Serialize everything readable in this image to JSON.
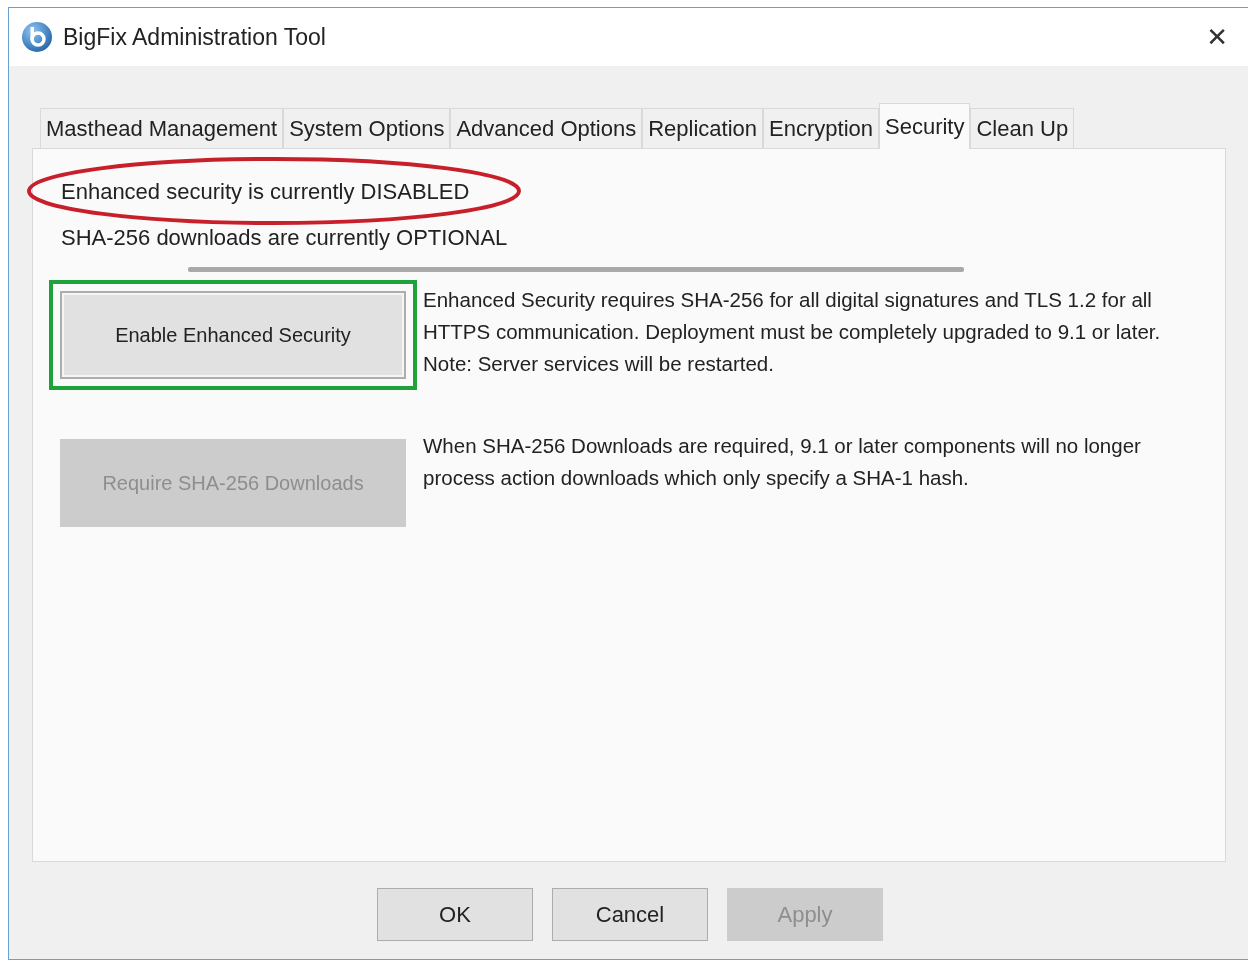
{
  "window": {
    "title": "BigFix Administration Tool",
    "close": "✕"
  },
  "tabs": [
    {
      "label": "Masthead Management",
      "selected": false
    },
    {
      "label": "System Options",
      "selected": false
    },
    {
      "label": "Advanced Options",
      "selected": false
    },
    {
      "label": "Replication",
      "selected": false
    },
    {
      "label": "Encryption",
      "selected": false
    },
    {
      "label": "Security",
      "selected": true
    },
    {
      "label": "Clean Up",
      "selected": false
    }
  ],
  "status_lines": [
    {
      "text": "Enhanced security is currently DISABLED",
      "circled": true
    },
    {
      "text": "SHA-256 downloads are currently OPTIONAL",
      "circled": false
    }
  ],
  "actions": [
    {
      "button": "Enable Enhanced Security",
      "disabled": false,
      "highlighted": true,
      "description": "Enhanced Security requires SHA-256 for all digital signatures and TLS 1.2 for all HTTPS communication. Deployment must be completely upgraded to 9.1 or later. Note: Server services will be restarted."
    },
    {
      "button": "Require SHA-256 Downloads",
      "disabled": true,
      "highlighted": false,
      "description": "When SHA-256 Downloads are required, 9.1 or later components will no longer process action downloads which only specify a SHA-1 hash."
    }
  ],
  "buttons": [
    {
      "label": "OK",
      "disabled": false
    },
    {
      "label": "Cancel",
      "disabled": false
    },
    {
      "label": "Apply",
      "disabled": true
    }
  ]
}
